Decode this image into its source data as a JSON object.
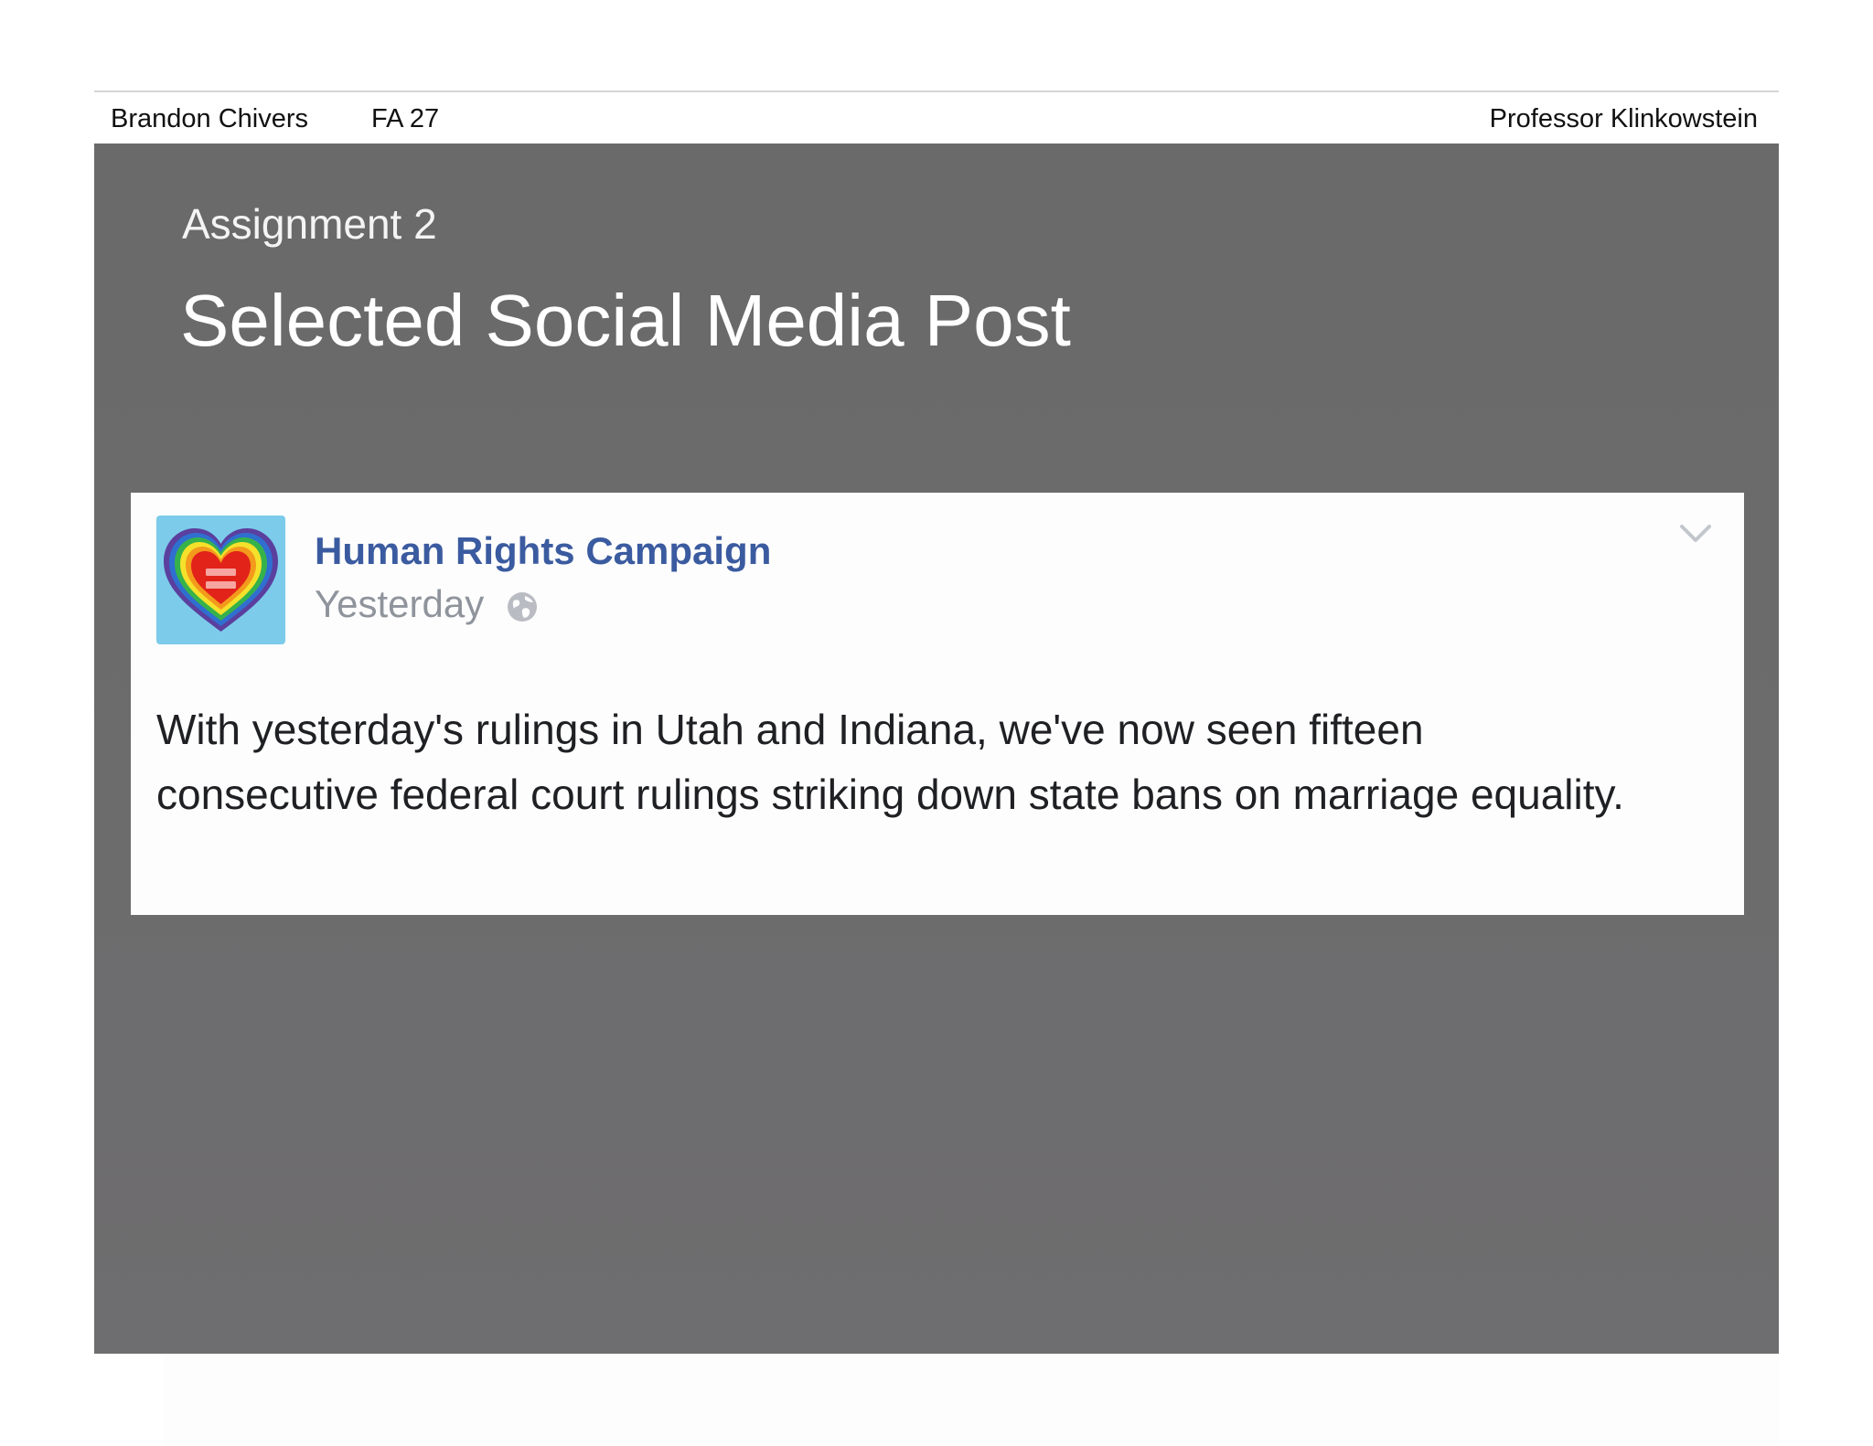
{
  "header": {
    "author": "Brandon Chivers",
    "course": "FA 27",
    "instructor": "Professor Klinkowstein"
  },
  "slide": {
    "kicker": "Assignment 2",
    "title": "Selected Social Media Post"
  },
  "post": {
    "page_name": "Human Rights Campaign",
    "time": "Yesterday",
    "privacy_icon": "globe-icon",
    "menu_icon": "chevron-down-icon",
    "avatar_icon": "rainbow-heart-equality-logo",
    "body": "With yesterday's rulings in Utah and Indiana, we've now seen fifteen consecutive federal court rulings striking down state bans on marriage equality."
  },
  "colors": {
    "slide_background": "#6b6b6b",
    "page_name": "#3b5ba0",
    "avatar_background": "#7ccbea",
    "meta_gray": "#8f949c"
  }
}
